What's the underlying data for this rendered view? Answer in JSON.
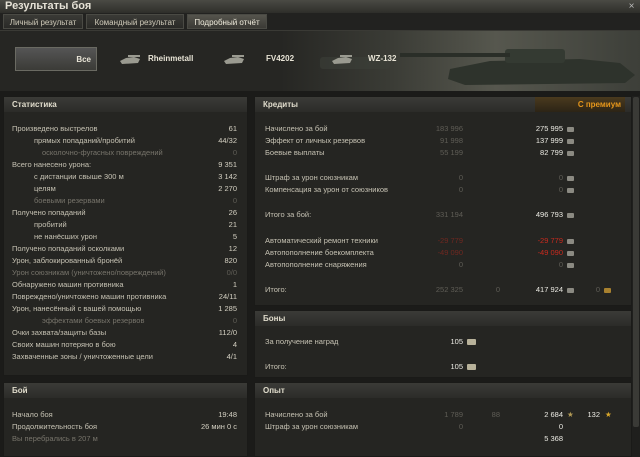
{
  "window": {
    "title": "Результаты боя",
    "close": "×"
  },
  "tabs": [
    {
      "label": "Личный результат"
    },
    {
      "label": "Командный результат"
    },
    {
      "label": "Подробный отчёт"
    }
  ],
  "vehicles": [
    {
      "label": "Все"
    },
    {
      "label": "Rheinmetall"
    },
    {
      "label": "FV4202"
    },
    {
      "label": "WZ-132"
    }
  ],
  "stats": {
    "title": "Статистика",
    "rows": [
      {
        "label": "Произведено выстрелов",
        "value": "61"
      },
      {
        "label": "прямых попаданий/пробитий",
        "value": "44/32"
      },
      {
        "label": "осколочно-фугасных повреждений",
        "value": "0"
      },
      {
        "label": "Всего нанесено урона:",
        "value": "9 351"
      },
      {
        "label": "с дистанции свыше 300 м",
        "value": "3 142"
      },
      {
        "label": "целям",
        "value": "2 270"
      },
      {
        "label": "боевыми резервами",
        "value": "0"
      },
      {
        "label": "Получено попаданий",
        "value": "26"
      },
      {
        "label": "пробитий",
        "value": "21"
      },
      {
        "label": "не нанёсших урон",
        "value": "5"
      },
      {
        "label": "Получено попаданий осколками",
        "value": "12"
      },
      {
        "label": "Урон, заблокированный бронёй",
        "value": "820"
      },
      {
        "label": "Урон союзникам (уничтожено/повреждений)",
        "value": "0/0"
      },
      {
        "label": "Обнаружено машин противника",
        "value": "1"
      },
      {
        "label": "Повреждено/уничтожено машин противника",
        "value": "24/11"
      },
      {
        "label": "Урон, нанесённый с вашей помощью",
        "value": "1 285"
      },
      {
        "label": "эффектами боевых резервов",
        "value": "0"
      },
      {
        "label": "Очки захвата/защиты базы",
        "value": "112/0"
      },
      {
        "label": "Своих машин потеряно в бою",
        "value": "4"
      },
      {
        "label": "Захваченные зоны / уничтоженные цели",
        "value": "4/1"
      }
    ]
  },
  "battle": {
    "title": "Бой",
    "rows": [
      {
        "label": "Начало боя",
        "value": "19:48"
      },
      {
        "label": "Продолжительность боя",
        "value": "26 мин 0 с"
      },
      {
        "label": "Вы перебрались в 207 м",
        "value": ""
      }
    ]
  },
  "credits": {
    "title": "Кредиты",
    "premium_label": "С премиум",
    "rows": [
      {
        "label": "Начислено за бой",
        "base": "183 996",
        "prem": "275 995"
      },
      {
        "label": "Эффект от личных резервов",
        "base": "91 998",
        "prem": "137 999"
      },
      {
        "label": "Боевые выплаты",
        "base": "55 199",
        "prem": "82 799"
      },
      {
        "label": "Штраф за урон союзникам",
        "base": "0",
        "prem": "0"
      },
      {
        "label": "Компенсация за урон от союзников",
        "base": "0",
        "prem": "0"
      },
      {
        "label": "Итого за бой:",
        "base": "331 194",
        "prem": "496 793"
      },
      {
        "label": "Автоматический ремонт техники",
        "base": "-29 779",
        "prem": "-29 779"
      },
      {
        "label": "Автопополнение боекомплекта",
        "base": "-49 090",
        "prem": "-49 090"
      },
      {
        "label": "Автопополнение снаряжения",
        "base": "0",
        "prem": "0"
      },
      {
        "label": "Итого:",
        "base": "252 325",
        "base2": "0",
        "prem": "417 924",
        "prem2": "0"
      }
    ]
  },
  "bonds": {
    "title": "Боны",
    "rows": [
      {
        "label": "За получение наград",
        "value": "105"
      },
      {
        "label": "Итого:",
        "value": "105"
      }
    ]
  },
  "xp": {
    "title": "Опыт",
    "rows": [
      {
        "label": "Начислено за бой",
        "base": "1 789",
        "base2": "88",
        "prem": "2 684",
        "prem2": "132"
      },
      {
        "label": "Штраф за урон союзникам",
        "base": "0",
        "prem": "0"
      },
      {
        "label": "",
        "base": "",
        "prem": "5 368"
      }
    ]
  }
}
